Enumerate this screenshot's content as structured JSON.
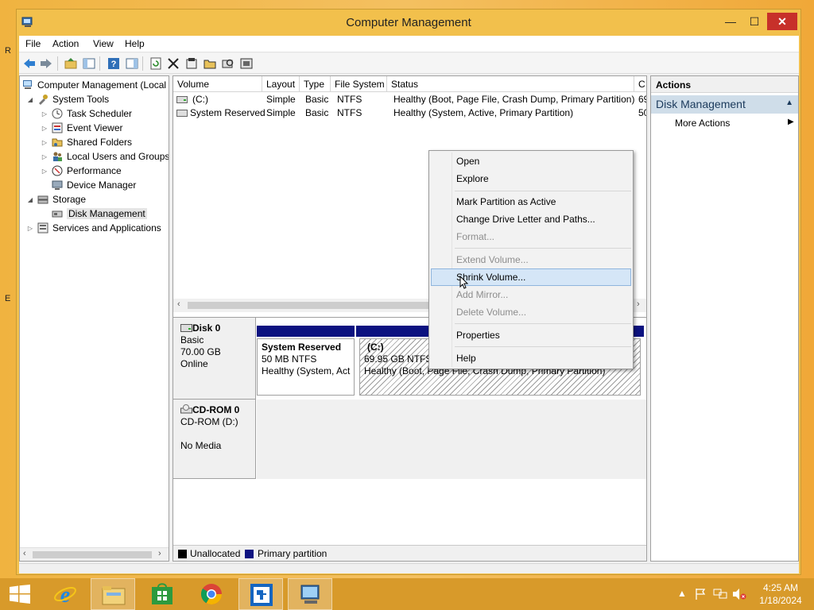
{
  "window": {
    "title": "Computer Management",
    "controls": {
      "minimize": "—",
      "maximize": "☐",
      "close": "✕"
    }
  },
  "menubar": {
    "items": [
      "File",
      "Action",
      "View",
      "Help"
    ]
  },
  "toolbar": {
    "icons": [
      "back-arrow-icon",
      "forward-arrow-icon",
      "up-folder-icon",
      "show-hide-tree-icon",
      "help-icon",
      "action-pane-icon",
      "refresh-icon",
      "delete-icon",
      "properties-icon",
      "open-folder-icon",
      "search-disk-icon",
      "settings-disk-icon"
    ]
  },
  "tree": {
    "items": [
      {
        "label": "Computer Management (Local",
        "expander": "",
        "icon": "computer-icon",
        "level": 0
      },
      {
        "label": "System Tools",
        "expander": "◢",
        "icon": "tools-icon",
        "level": 1
      },
      {
        "label": "Task Scheduler",
        "expander": "▷",
        "icon": "clock-icon",
        "level": 2
      },
      {
        "label": "Event Viewer",
        "expander": "▷",
        "icon": "event-viewer-icon",
        "level": 2
      },
      {
        "label": "Shared Folders",
        "expander": "▷",
        "icon": "shared-folder-icon",
        "level": 2
      },
      {
        "label": "Local Users and Groups",
        "expander": "▷",
        "icon": "users-icon",
        "level": 2
      },
      {
        "label": "Performance",
        "expander": "▷",
        "icon": "performance-icon",
        "level": 2
      },
      {
        "label": "Device Manager",
        "expander": "",
        "icon": "device-manager-icon",
        "level": 2
      },
      {
        "label": "Storage",
        "expander": "◢",
        "icon": "storage-icon",
        "level": 1
      },
      {
        "label": "Disk Management",
        "expander": "",
        "icon": "disk-management-icon",
        "level": 2,
        "selected": true
      },
      {
        "label": "Services and Applications",
        "expander": "▷",
        "icon": "services-icon",
        "level": 1
      }
    ]
  },
  "volumes": {
    "columns": [
      "Volume",
      "Layout",
      "Type",
      "File System",
      "Status",
      "C"
    ],
    "rows": [
      {
        "volume": "(C:)",
        "layout": "Simple",
        "type": "Basic",
        "fs": "NTFS",
        "status": "Healthy (Boot, Page File, Crash Dump, Primary Partition)",
        "c": "69"
      },
      {
        "volume": "System Reserved",
        "layout": "Simple",
        "type": "Basic",
        "fs": "NTFS",
        "status": "Healthy (System, Active, Primary Partition)",
        "c": "50"
      }
    ]
  },
  "disks": {
    "disk0": {
      "name": "Disk 0",
      "type": "Basic",
      "size": "70.00 GB",
      "state": "Online",
      "partitions": [
        {
          "name": "System Reserved",
          "size": "50 MB NTFS",
          "status": "Healthy (System, Act"
        },
        {
          "name": "(C:)",
          "size": "69.95 GB NTFS",
          "status": "Healthy (Boot, Page File, Crash Dump, Primary Partition)"
        }
      ]
    },
    "cdrom0": {
      "name": "CD-ROM 0",
      "type": "CD-ROM (D:)",
      "state": "No Media"
    }
  },
  "legend": {
    "items": [
      {
        "label": "Unallocated",
        "color": "#000000"
      },
      {
        "label": "Primary partition",
        "color": "#0c1280"
      }
    ]
  },
  "actions": {
    "header": "Actions",
    "section": "Disk Management",
    "more": "More Actions"
  },
  "context_menu": {
    "items": [
      {
        "label": "Open",
        "disabled": false
      },
      {
        "label": "Explore",
        "disabled": false
      },
      {
        "label": "Mark Partition as Active",
        "disabled": false
      },
      {
        "label": "Change Drive Letter and Paths...",
        "disabled": false
      },
      {
        "label": "Format...",
        "disabled": true
      },
      {
        "label": "Extend Volume...",
        "disabled": true
      },
      {
        "label": "Shrink Volume...",
        "disabled": false,
        "hover": true
      },
      {
        "label": "Add Mirror...",
        "disabled": true
      },
      {
        "label": "Delete Volume...",
        "disabled": true
      },
      {
        "label": "Properties",
        "disabled": false
      },
      {
        "label": "Help",
        "disabled": false
      }
    ]
  },
  "taskbar": {
    "time": "4:25 AM",
    "date": "1/18/2024",
    "apps": [
      "start-icon",
      "internet-explorer-icon",
      "file-explorer-icon",
      "store-icon",
      "chrome-icon",
      "migration-tool-icon",
      "computer-management-icon"
    ]
  },
  "desktop": {
    "edge_labels": [
      "R",
      "E"
    ]
  },
  "colors": {
    "primary_partition": "#0c1280",
    "close_button": "#c7302a",
    "taskbar": "#d89a2a",
    "selection": "#d5e6f7"
  }
}
